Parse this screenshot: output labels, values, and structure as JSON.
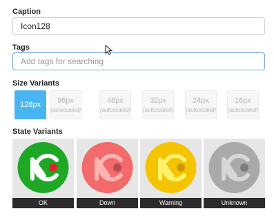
{
  "caption": {
    "label": "Caption",
    "value": "Icon128"
  },
  "tags": {
    "label": "Tags",
    "placeholder": "Add tags for searching"
  },
  "size_variants": {
    "label": "Size Variants",
    "items": [
      {
        "size": "128px",
        "note": "",
        "selected": true
      },
      {
        "size": "96px",
        "note": "(autoscaled)",
        "selected": false
      },
      {
        "size": "48px",
        "note": "(autoscaled)",
        "selected": false
      },
      {
        "size": "32px",
        "note": "(autoscaled)",
        "selected": false
      },
      {
        "size": "24px",
        "note": "(autoscaled)",
        "selected": false
      },
      {
        "size": "16px",
        "note": "(autoscaled)",
        "selected": false
      }
    ]
  },
  "state_variants": {
    "label": "State Variants",
    "items": [
      {
        "name": "OK",
        "circle_color": "#1ea826",
        "glyph_color": "#ffffff",
        "dot_color": "#e0242b"
      },
      {
        "name": "Down",
        "circle_color": "#f26a6a",
        "glyph_color": "#ffb3b3",
        "dot_color": "#b84a4a"
      },
      {
        "name": "Warning",
        "circle_color": "#f5c400",
        "glyph_color": "#fff16a",
        "dot_color": "#c99a00"
      },
      {
        "name": "Unknown",
        "circle_color": "#a8aaaa",
        "glyph_color": "#d6d7d7",
        "dot_color": "#7c7e7e"
      }
    ]
  }
}
